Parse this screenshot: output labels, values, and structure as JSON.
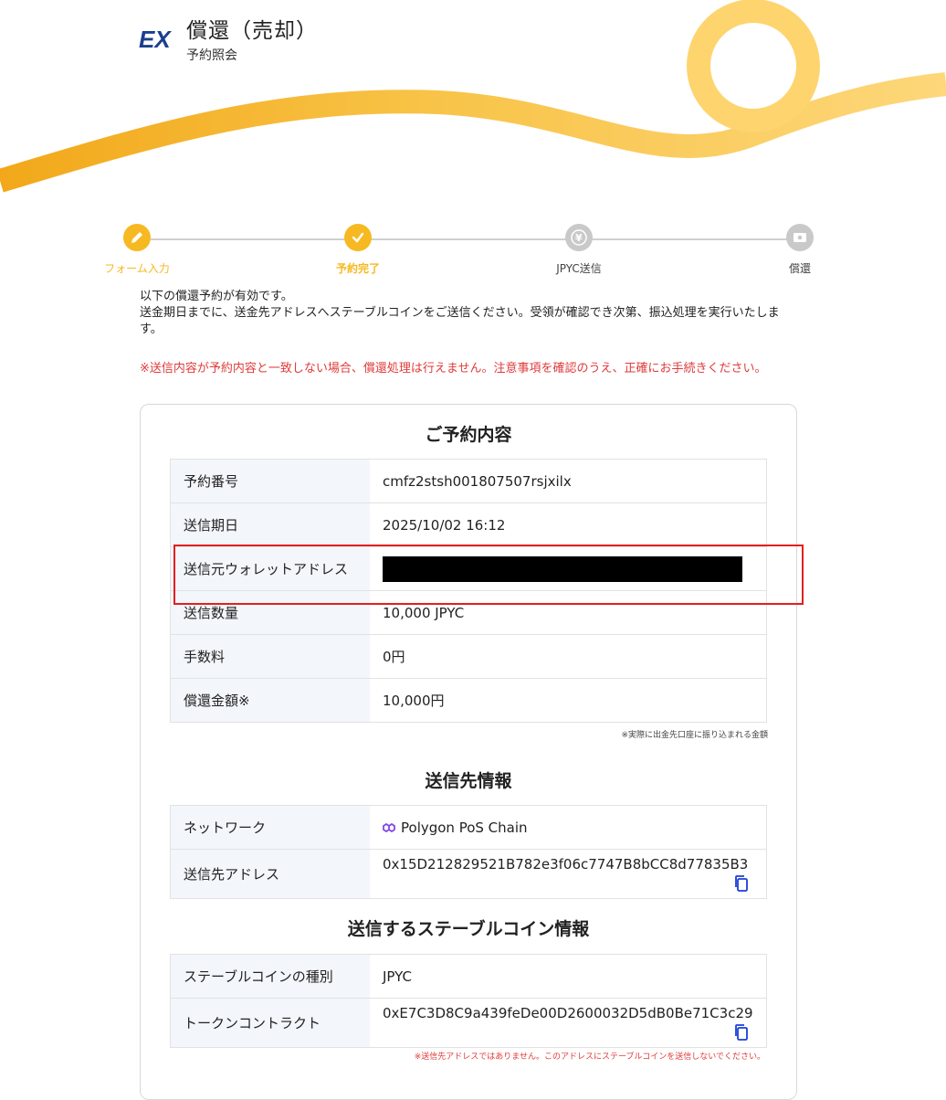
{
  "header": {
    "logo_text": "EX",
    "title": "償還（売却）",
    "subtitle": "予約照会"
  },
  "steps": [
    {
      "label": "フォーム入力",
      "icon": "pencil-icon",
      "state": "done"
    },
    {
      "label": "予約完了",
      "icon": "check-icon",
      "state": "current"
    },
    {
      "label": "JPYC送信",
      "icon": "yen-icon",
      "state": "todo"
    },
    {
      "label": "償還",
      "icon": "cash-icon",
      "state": "todo"
    }
  ],
  "intro": {
    "line1": "以下の償還予約が有効です。",
    "line2": "送金期日までに、送金先アドレスへステーブルコインをご送信ください。受領が確認でき次第、振込処理を実行いたします。",
    "warning": "※送信内容が予約内容と一致しない場合、償還処理は行えません。注意事項を確認のうえ、正確にお手続きください。"
  },
  "reservation": {
    "title": "ご予約内容",
    "rows": [
      {
        "label": "予約番号",
        "value": "cmfz2stsh001807507rsjxilx"
      },
      {
        "label": "送信期日",
        "value": "2025/10/02 16:12"
      },
      {
        "label": "送信元ウォレットアドレス",
        "value": ""
      },
      {
        "label": "送信数量",
        "value": "10,000 JPYC"
      },
      {
        "label": "手数料",
        "value": "0円"
      },
      {
        "label": "償還金額※",
        "value": "10,000円"
      }
    ],
    "note": "※実際に出金先口座に振り込まれる金額"
  },
  "destination": {
    "title": "送信先情報",
    "network_label": "ネットワーク",
    "network_value": "Polygon PoS Chain",
    "address_label": "送信先アドレス",
    "address_value": "0x15D212829521B782e3f06c7747B8bCC8d77835B3"
  },
  "stablecoin": {
    "title": "送信するステーブルコイン情報",
    "type_label": "ステーブルコインの種別",
    "type_value": "JPYC",
    "contract_label": "トークンコントラクト",
    "contract_value": "0xE7C3D8C9a439feDe00D2600032D5dB0Be71C3c29",
    "note": "※送信先アドレスではありません。このアドレスにステーブルコインを送信しないでください。"
  },
  "colors": {
    "accent": "#f6b921",
    "warning": "#e03a3a",
    "highlight": "#e02020",
    "copy_icon": "#1a3fd9",
    "polygon": "#8247e5"
  }
}
